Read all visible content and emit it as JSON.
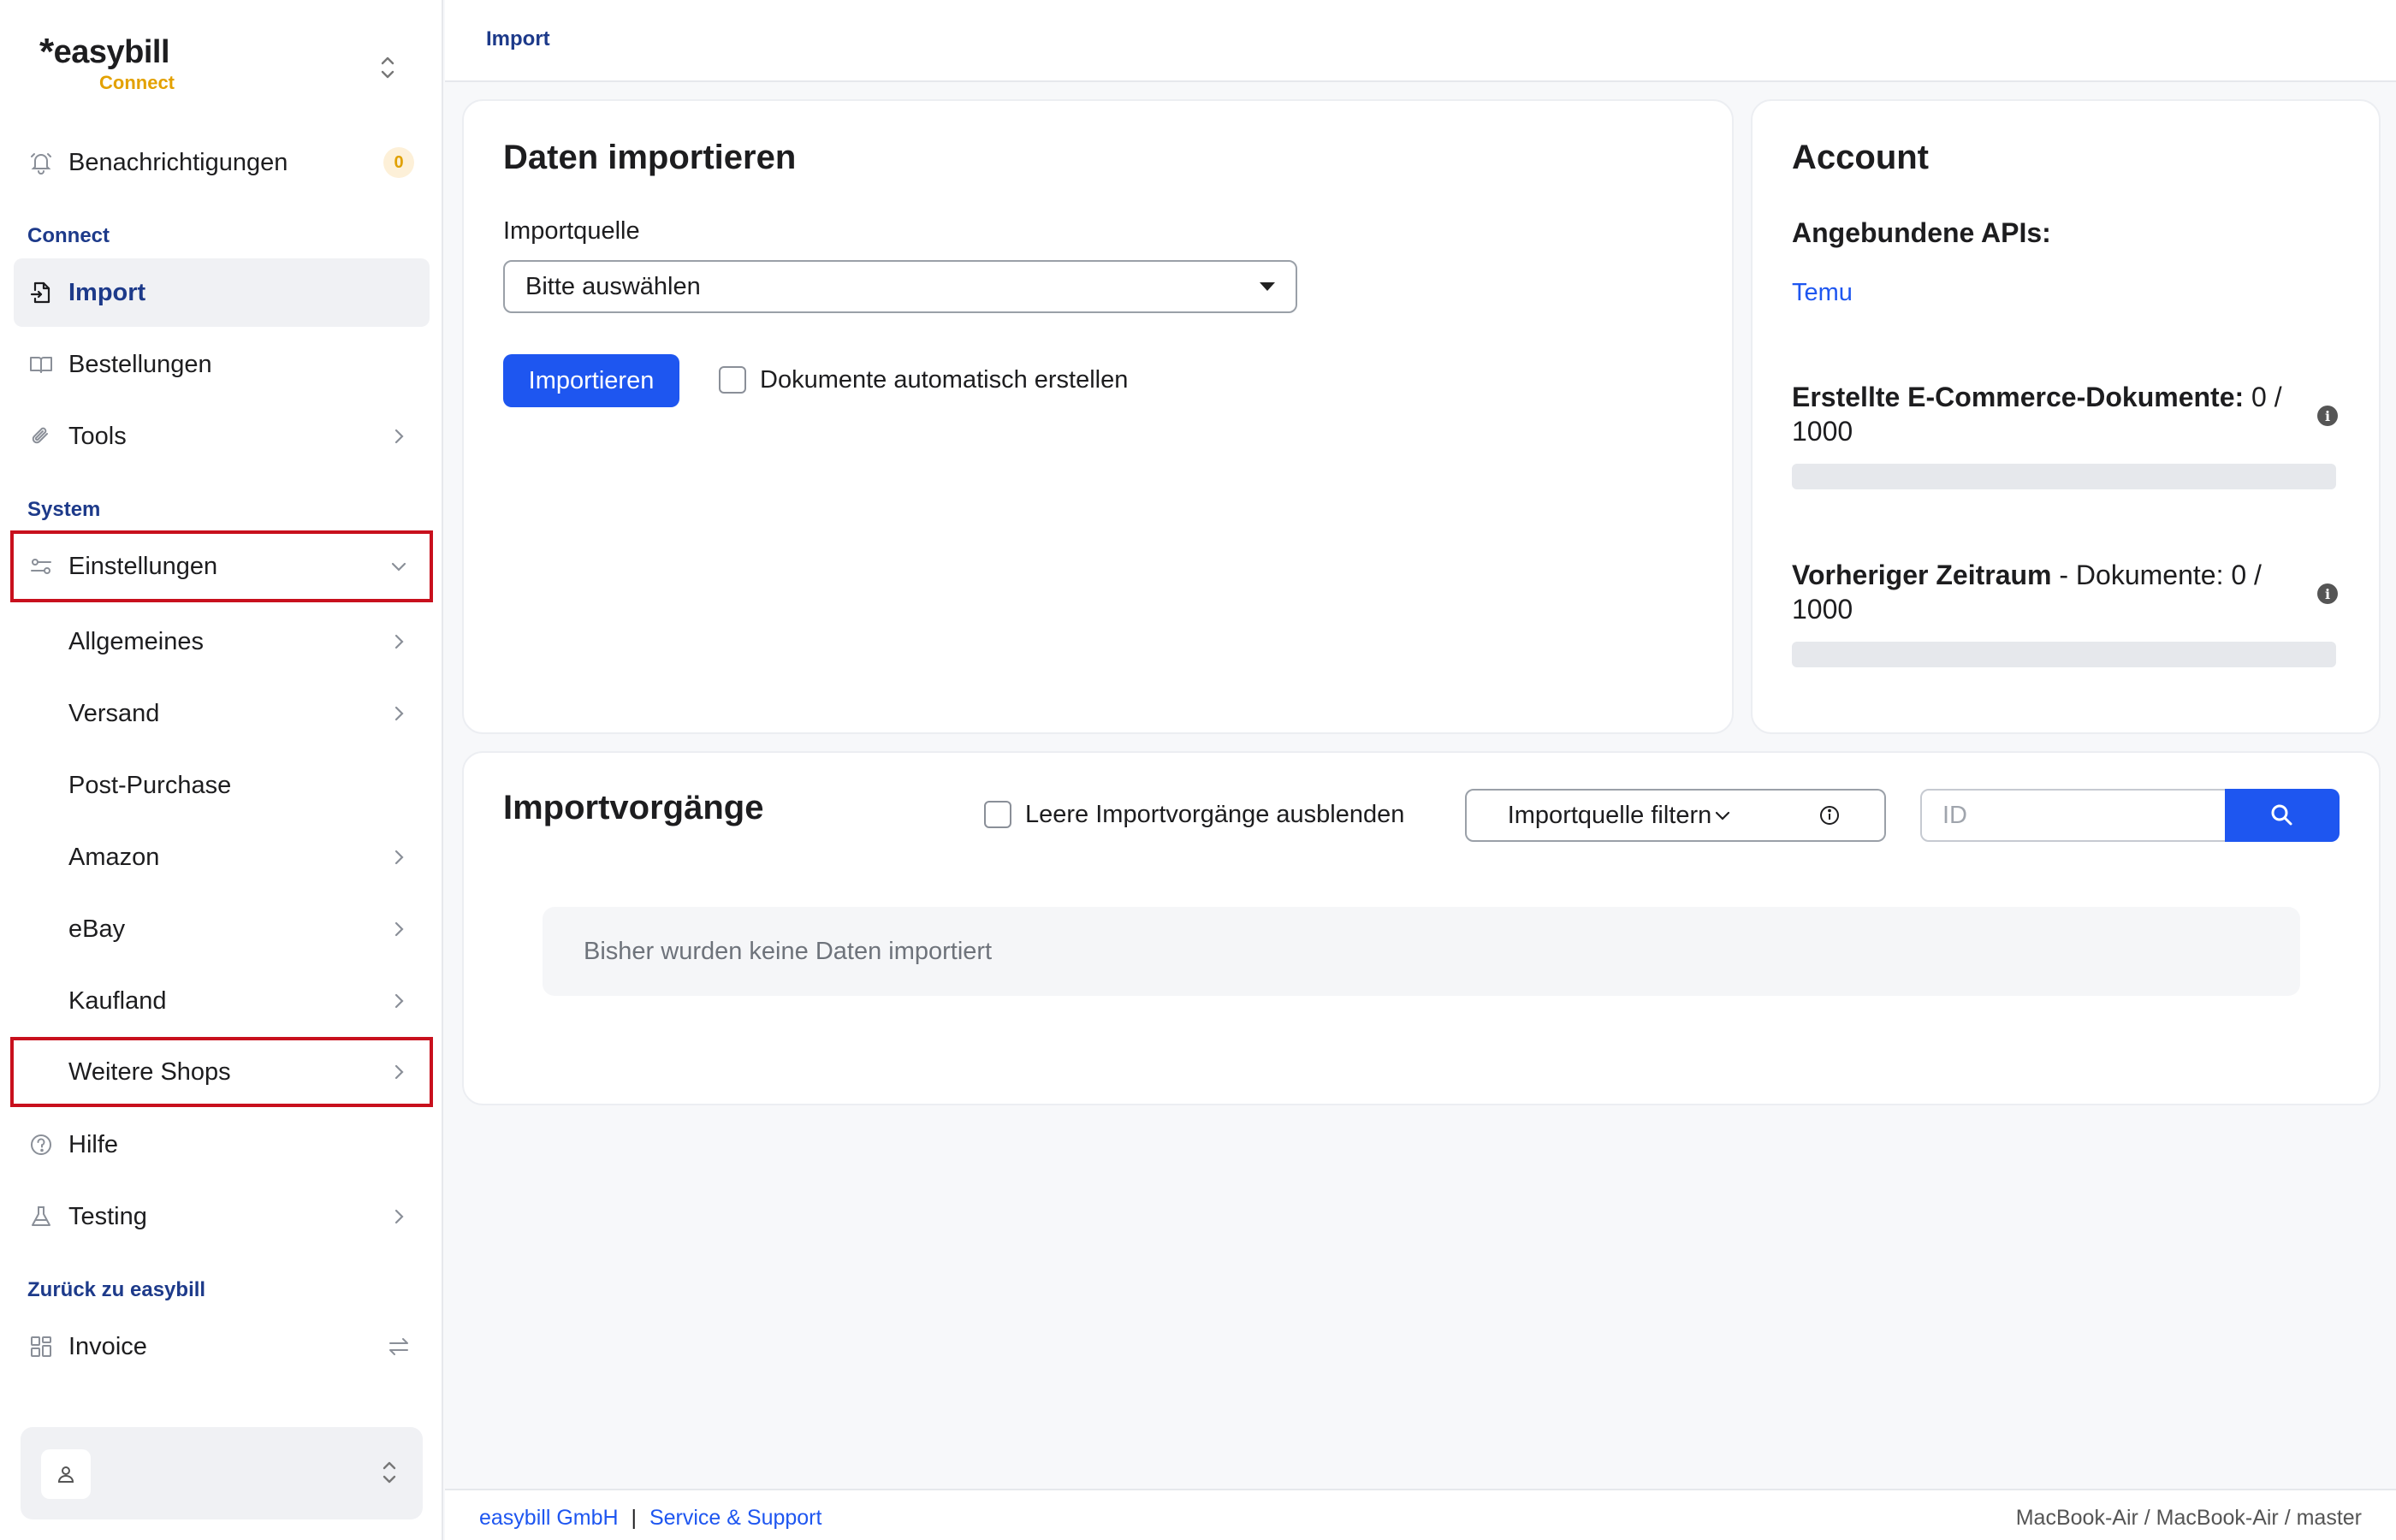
{
  "brand": {
    "name": "easybill",
    "sub": "Connect"
  },
  "notifications": {
    "label": "Benachrichtigungen",
    "count": "0"
  },
  "sections": {
    "connect": "Connect",
    "system": "System",
    "back": "Zurück zu easybill"
  },
  "nav": {
    "import": "Import",
    "orders": "Bestellungen",
    "tools": "Tools",
    "settings": "Einstellungen",
    "general": "Allgemeines",
    "shipping": "Versand",
    "post_purchase": "Post-Purchase",
    "amazon": "Amazon",
    "ebay": "eBay",
    "kaufland": "Kaufland",
    "more_shops": "Weitere Shops",
    "help": "Hilfe",
    "testing": "Testing",
    "invoice": "Invoice"
  },
  "breadcrumb": "Import",
  "import_card": {
    "title": "Daten importieren",
    "source_label": "Importquelle",
    "source_value": "Bitte auswählen",
    "import_button": "Importieren",
    "auto_create_label": "Dokumente automatisch erstellen"
  },
  "account_card": {
    "title": "Account",
    "apis_label": "Angebundene APIs:",
    "api_link": "Temu",
    "ecommerce_label": "Erstellte E-Commerce-Dokumente:",
    "ecommerce_value": "0 / 1000",
    "ecommerce_progress": 0,
    "previous_label_bold": "Vorheriger Zeitraum",
    "previous_label_rest": " - Dokumente:",
    "previous_value": "0 / 1000",
    "previous_progress": 0
  },
  "imports_card": {
    "title": "Importvorgänge",
    "hide_empty_label": "Leere Importvorgänge ausblenden",
    "filter_button": "Importquelle filtern",
    "id_placeholder": "ID",
    "empty_text": "Bisher wurden keine Daten importiert"
  },
  "footer": {
    "company": "easybill GmbH",
    "separator": "|",
    "support": "Service & Support",
    "env": "MacBook-Air / MacBook-Air / master"
  }
}
